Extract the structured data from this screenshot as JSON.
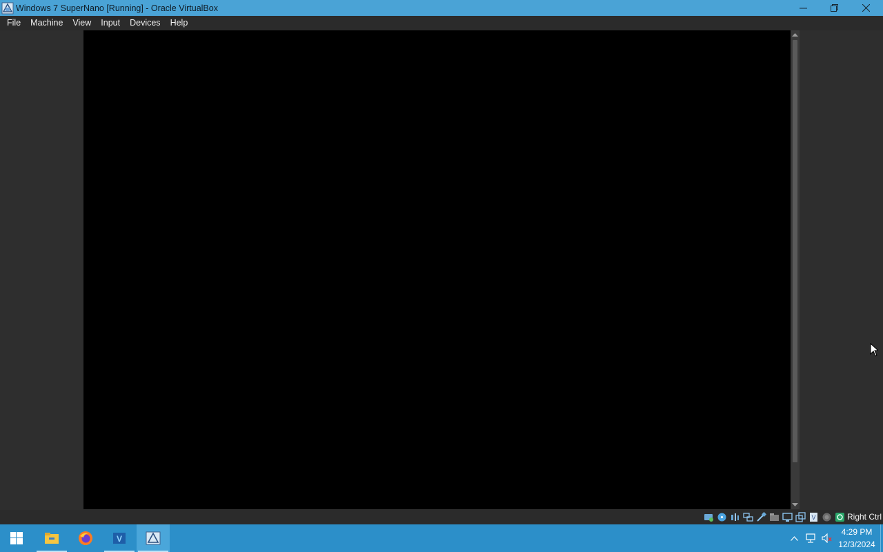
{
  "window": {
    "title": "Windows 7 SuperNano [Running] - Oracle VirtualBox",
    "icon": "virtualbox-vm-icon",
    "controls": [
      "minimize-icon",
      "restore-icon",
      "close-icon"
    ]
  },
  "menubar": {
    "items": [
      "File",
      "Machine",
      "View",
      "Input",
      "Devices",
      "Help"
    ]
  },
  "vm_display": {
    "content": "black-screen"
  },
  "statusbar": {
    "icons": [
      "hard-disk-icon",
      "optical-drive-icon",
      "audio-icon",
      "network-icon",
      "usb-icon",
      "shared-folders-icon",
      "display-icon",
      "video-capture-icon",
      "virtualization-icon",
      "mouse-integration-icon",
      "keyboard-icon"
    ],
    "host_key": "Right Ctrl"
  },
  "taskbar": {
    "apps": [
      "start-windows-icon",
      "file-explorer-icon",
      "firefox-icon",
      "virtualbox-manager-icon",
      "virtualbox-vm-icon"
    ],
    "tray_icons": [
      "show-hidden-icons-icon",
      "network-icon",
      "volume-muted-icon"
    ],
    "time": "4:29 PM",
    "date": "12/3/2024"
  },
  "colors": {
    "titlebar": "#4aa3d6",
    "taskbar": "#2c8fc9",
    "workspace": "#2e2e2e"
  }
}
